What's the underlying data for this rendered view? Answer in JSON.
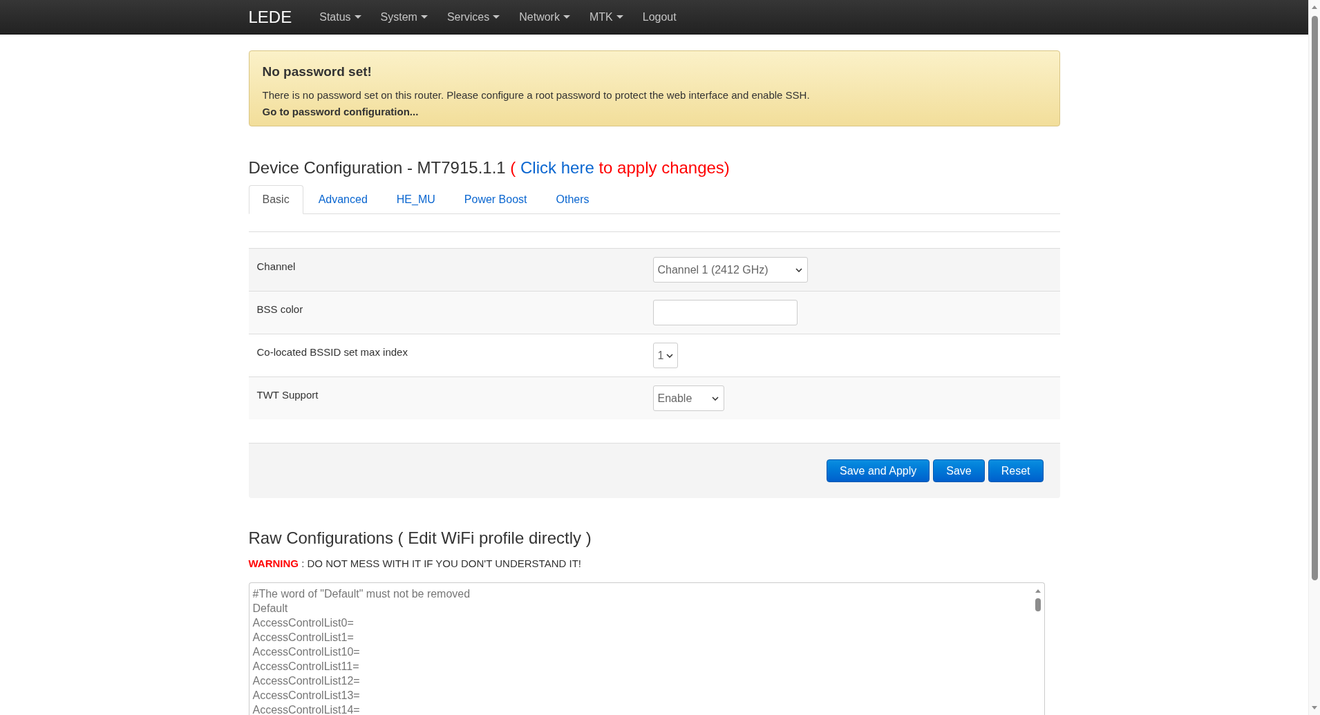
{
  "navbar": {
    "brand": "LEDE",
    "menu": [
      {
        "label": "Status",
        "kind": "dropdown"
      },
      {
        "label": "System",
        "kind": "dropdown"
      },
      {
        "label": "Services",
        "kind": "dropdown"
      },
      {
        "label": "Network",
        "kind": "dropdown"
      },
      {
        "label": "MTK",
        "kind": "dropdown"
      },
      {
        "label": "Logout",
        "kind": "link"
      }
    ]
  },
  "alert": {
    "title": "No password set!",
    "message": "There is no password set on this router. Please configure a root password to protect the web interface and enable SSH.",
    "link": "Go to password configuration..."
  },
  "device_configuration": {
    "title": "Device Configuration - MT7915.1.1",
    "apply_prefix": "(",
    "apply_link": "Click here",
    "apply_suffix": "to apply changes)",
    "tabs": [
      {
        "label": "Basic",
        "selected": true
      },
      {
        "label": "Advanced",
        "selected": false
      },
      {
        "label": "HE_MU",
        "selected": false
      },
      {
        "label": "Power Boost",
        "selected": false
      },
      {
        "label": "Others",
        "selected": false
      }
    ],
    "fields": [
      {
        "label": "Channel",
        "kind": "select",
        "value": "Channel 1 (2412 GHz)"
      },
      {
        "label": "BSS color",
        "kind": "text"
      },
      {
        "label": "Co-located BSSID set max index",
        "kind": "select",
        "value": "1"
      },
      {
        "label": "TWT Support",
        "kind": "select",
        "value": "Enable"
      }
    ],
    "buttons": [
      "Save and Apply",
      "Save",
      "Reset"
    ]
  },
  "raw_configurations": {
    "title": "Raw Configurations ( Edit WiFi profile directly )",
    "warning_label": "WARNING",
    "warning_text": ": DO NOT MESS WITH IT IF YOU DON'T UNDERSTAND IT!",
    "lines": [
      "#The word of \"Default\" must not be removed",
      "Default",
      "AccessControlList0=",
      "AccessControlList1=",
      "AccessControlList10=",
      "AccessControlList11=",
      "AccessControlList12=",
      "AccessControlList13=",
      "AccessControlList14="
    ]
  }
}
